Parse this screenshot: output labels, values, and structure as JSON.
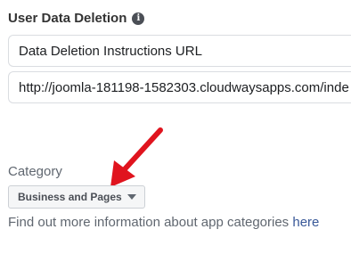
{
  "section": {
    "title": "User Data Deletion",
    "info_icon": "info-icon",
    "info_glyph": "i"
  },
  "fields": {
    "deletion_type": "Data Deletion Instructions URL",
    "deletion_url": "http://joomla-181198-1582303.cloudwaysapps.com/inde"
  },
  "category": {
    "label": "Category",
    "selected": "Business and Pages"
  },
  "help": {
    "text": "Find out more information about app categories ",
    "link": "here"
  },
  "annotation": {
    "arrow_color": "#e0141e",
    "icon": "red-arrow-icon"
  }
}
